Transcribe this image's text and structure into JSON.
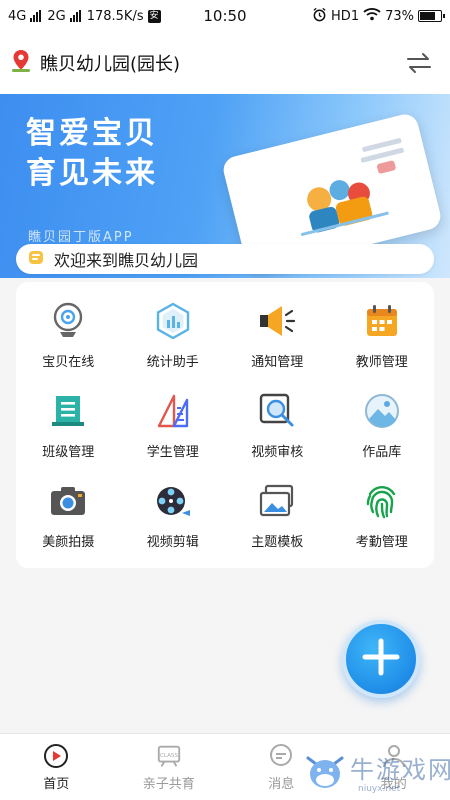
{
  "status_bar": {
    "net1": "4G",
    "net2": "2G",
    "speed": "178.5K/s",
    "time": "10:50",
    "hd": "HD1",
    "battery": "73%",
    "battery_level": 0.73
  },
  "header": {
    "school": "瞧贝幼儿园(园长)"
  },
  "banner": {
    "line1": "智爱宝贝",
    "line2": "育见未来",
    "subtitle": "瞧贝园丁版APP"
  },
  "welcome": {
    "text": "欢迎来到瞧贝幼儿园"
  },
  "grid": {
    "items": [
      {
        "label": "宝贝在线",
        "icon": "webcam-icon"
      },
      {
        "label": "统计助手",
        "icon": "statistics-icon"
      },
      {
        "label": "通知管理",
        "icon": "megaphone-icon"
      },
      {
        "label": "教师管理",
        "icon": "calendar-icon"
      },
      {
        "label": "班级管理",
        "icon": "class-icon"
      },
      {
        "label": "学生管理",
        "icon": "ruler-icon"
      },
      {
        "label": "视频审核",
        "icon": "video-search-icon"
      },
      {
        "label": "作品库",
        "icon": "gallery-icon"
      },
      {
        "label": "美颜拍摄",
        "icon": "camera-icon"
      },
      {
        "label": "视频剪辑",
        "icon": "film-reel-icon"
      },
      {
        "label": "主题模板",
        "icon": "template-icon"
      },
      {
        "label": "考勤管理",
        "icon": "fingerprint-icon"
      }
    ]
  },
  "tabs": [
    {
      "label": "首页",
      "icon": "home-play-icon",
      "active": true
    },
    {
      "label": "亲子共育",
      "icon": "class-board-icon",
      "active": false
    },
    {
      "label": "消息",
      "icon": "message-icon",
      "active": false
    },
    {
      "label": "我的",
      "icon": "profile-icon",
      "active": false
    }
  ],
  "watermark": {
    "text": "牛游戏网",
    "url": "niuyx.net"
  },
  "colors": {
    "accent_blue": "#2d8cf0",
    "fab_blue": "#1f8de8",
    "orange": "#f5a623",
    "teal": "#2bb3a8",
    "green": "#16a34a"
  }
}
